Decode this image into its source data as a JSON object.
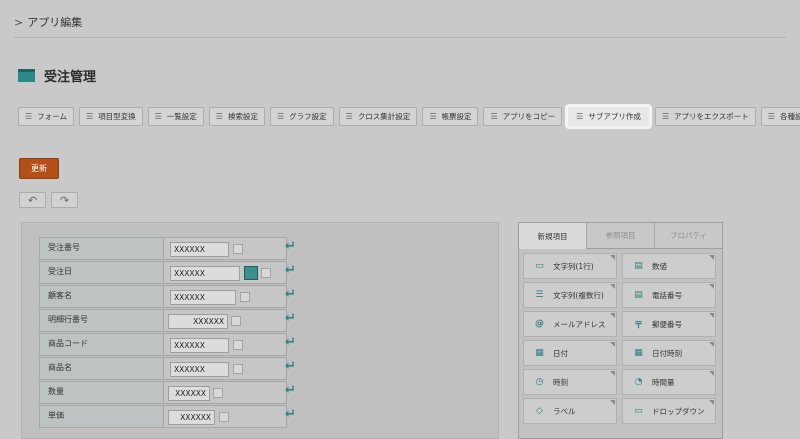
{
  "breadcrumb": {
    "chevron": ">",
    "label": "アプリ編集"
  },
  "page": {
    "title": "受注管理",
    "icon": "table-icon"
  },
  "tabs": [
    {
      "label": "フォーム",
      "selected": false
    },
    {
      "label": "項目型変換",
      "selected": false
    },
    {
      "label": "一覧設定",
      "selected": false
    },
    {
      "label": "検索設定",
      "selected": false
    },
    {
      "label": "グラフ設定",
      "selected": false
    },
    {
      "label": "クロス集計設定",
      "selected": false
    },
    {
      "label": "帳票設定",
      "selected": false
    },
    {
      "label": "アプリをコピー",
      "selected": false
    },
    {
      "label": "サブアプリ作成",
      "selected": true
    },
    {
      "label": "アプリをエクスポート",
      "selected": false
    },
    {
      "label": "各種設定",
      "selected": false
    }
  ],
  "actions": {
    "update_label": "更新",
    "undo_glyph": "↶",
    "redo_glyph": "↷",
    "hamburger_glyph": "☰"
  },
  "form": {
    "rows": [
      {
        "label": "受注番号",
        "value": "XXXXXX"
      },
      {
        "label": "受注日",
        "value": "XXXXXX"
      },
      {
        "label": "顧客名",
        "value": "XXXXXX"
      },
      {
        "label": "明細行番号",
        "value": "XXXXXX"
      },
      {
        "label": "商品コード",
        "value": "XXXXXX"
      },
      {
        "label": "商品名",
        "value": "XXXXXX"
      },
      {
        "label": "数量",
        "value": "XXXXXX"
      },
      {
        "label": "単価",
        "value": "XXXXXX"
      }
    ],
    "enter_glyph": "↵"
  },
  "panel": {
    "tabs": [
      {
        "label": "新規項目",
        "active": true
      },
      {
        "label": "参照項目",
        "active": false
      },
      {
        "label": "プロパティ",
        "active": false
      }
    ],
    "fields": [
      {
        "label": "文字列(1行)",
        "icon": "single-line-text-icon"
      },
      {
        "label": "数値",
        "icon": "number-icon"
      },
      {
        "label": "文字列(複数行)",
        "icon": "multi-line-text-icon"
      },
      {
        "label": "電話番号",
        "icon": "phone-icon"
      },
      {
        "label": "メールアドレス",
        "icon": "at-sign-icon"
      },
      {
        "label": "郵便番号",
        "icon": "postal-mark-icon"
      },
      {
        "label": "日付",
        "icon": "calendar-icon"
      },
      {
        "label": "日付時刻",
        "icon": "calendar-clock-icon"
      },
      {
        "label": "時刻",
        "icon": "clock-icon"
      },
      {
        "label": "時間量",
        "icon": "duration-icon"
      },
      {
        "label": "ラベル",
        "icon": "tag-icon"
      },
      {
        "label": "ドロップダウン",
        "icon": "dropdown-icon"
      }
    ]
  },
  "colors": {
    "accent": "#2b8a7f",
    "update_button": "#b3501a",
    "background": "#c9c9c9"
  }
}
